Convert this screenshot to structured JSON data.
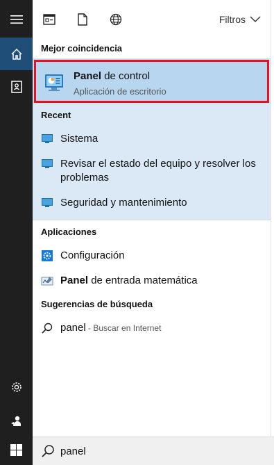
{
  "toolbar": {
    "filters_label": "Filtros"
  },
  "sections": {
    "best_match": "Mejor coincidencia",
    "recent": "Recent",
    "apps": "Aplicaciones",
    "suggestions": "Sugerencias de búsqueda"
  },
  "best_match": {
    "title_bold": "Panel",
    "title_rest": " de control",
    "subtitle": "Aplicación de escritorio"
  },
  "recent": [
    {
      "label": "Sistema"
    },
    {
      "label": "Revisar el estado del equipo y resolver los problemas"
    },
    {
      "label": "Seguridad y mantenimiento"
    }
  ],
  "apps": [
    {
      "label": "Configuración"
    },
    {
      "label_bold": "Panel",
      "label_rest": " de entrada matemática"
    }
  ],
  "suggestion": {
    "term": "panel",
    "suffix": " - Buscar en Internet"
  },
  "search": {
    "value": "panel"
  },
  "colors": {
    "rail_bg": "#1f1f1f",
    "rail_active": "#1f4e79",
    "best_bg": "#b8d6f0",
    "recent_bg": "#dbe9f6",
    "highlight_border": "#e81123"
  },
  "icons": {
    "rail": [
      "hamburger-icon",
      "home-icon",
      "notebook-icon",
      "settings-icon",
      "feedback-icon",
      "windows-icon"
    ],
    "toolbar": [
      "apps-filter-icon",
      "documents-filter-icon",
      "web-filter-icon",
      "chevron-down-icon"
    ]
  }
}
